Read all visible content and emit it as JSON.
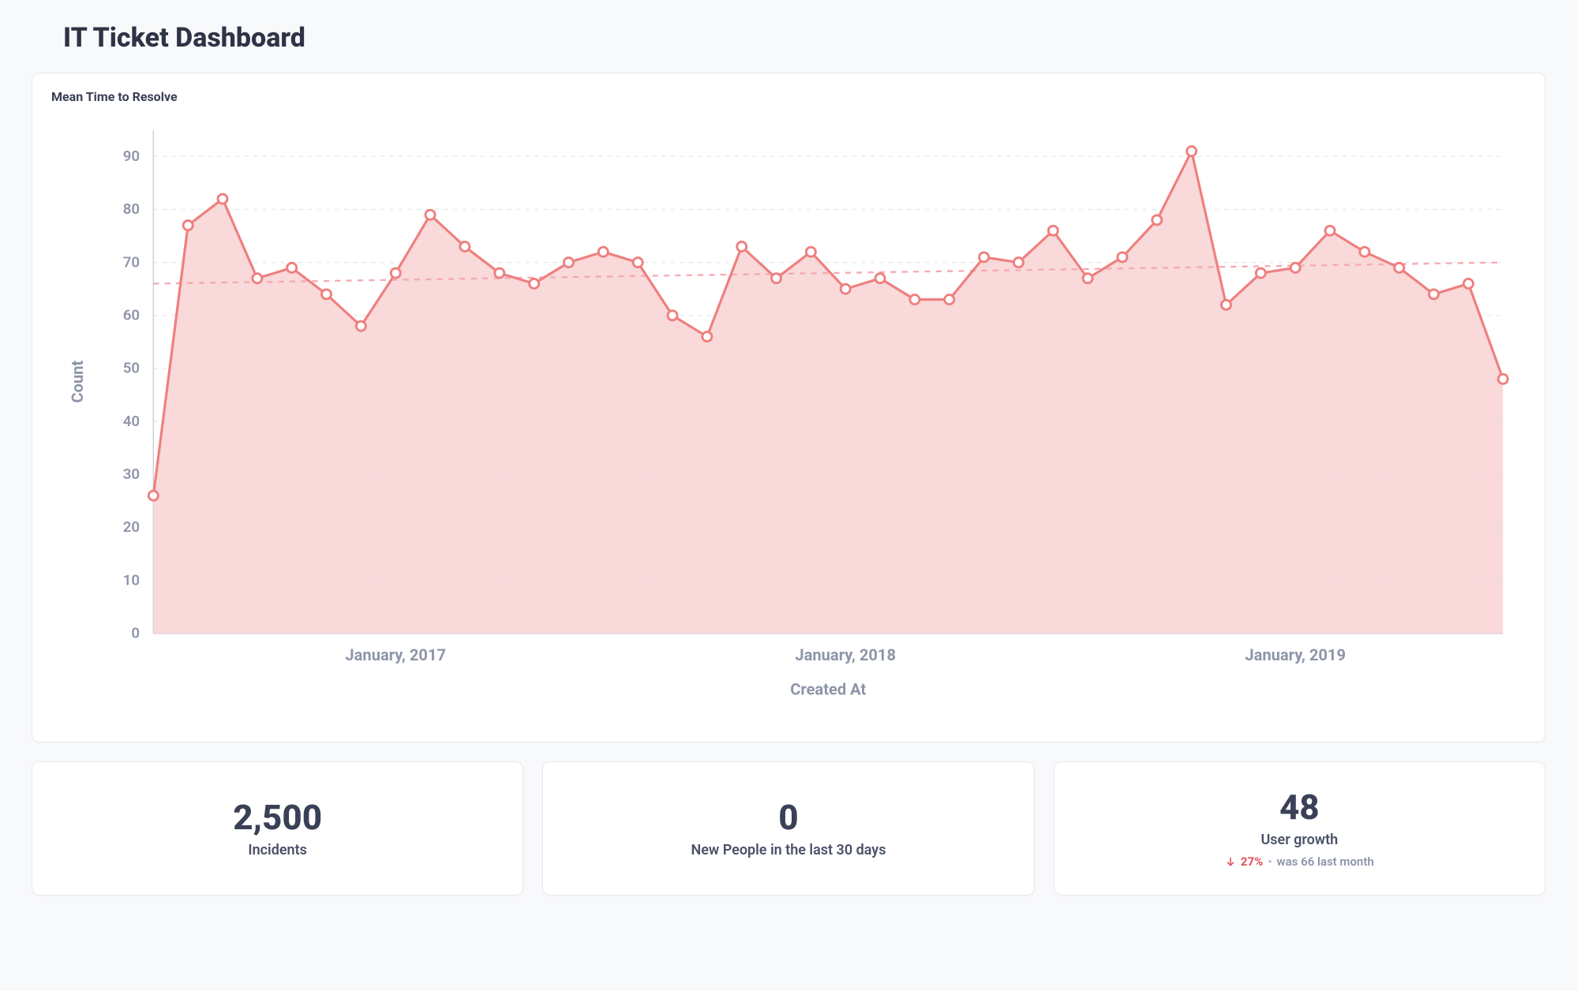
{
  "page_title": "IT Ticket Dashboard",
  "chart": {
    "title": "Mean Time to Resolve",
    "xlabel": "Created At",
    "ylabel": "Count"
  },
  "chart_data": {
    "type": "area",
    "ylabel": "Count",
    "xlabel": "Created At",
    "title": "Mean Time to Resolve",
    "ylim": [
      0,
      95
    ],
    "y_ticks": [
      0,
      10,
      20,
      30,
      40,
      50,
      60,
      70,
      80,
      90
    ],
    "x_tick_labels": [
      "January, 2017",
      "January, 2018",
      "January, 2019"
    ],
    "x_tick_positions": [
      7,
      20,
      33
    ],
    "series": [
      {
        "name": "Mean Time to Resolve",
        "values": [
          26,
          77,
          82,
          67,
          69,
          64,
          58,
          68,
          79,
          73,
          68,
          66,
          70,
          72,
          70,
          60,
          56,
          73,
          67,
          72,
          65,
          67,
          63,
          63,
          71,
          70,
          76,
          67,
          71,
          78,
          91,
          62,
          68,
          69,
          76,
          72,
          69,
          64,
          66,
          48
        ]
      }
    ],
    "goal": {
      "start_value": 66,
      "end_value": 70
    }
  },
  "stats": {
    "incidents": {
      "value": "2,500",
      "label": "Incidents"
    },
    "new_people": {
      "value": "0",
      "label": "New People in the last 30 days"
    },
    "user_growth": {
      "value": "48",
      "label": "User growth",
      "change_pct": "27%",
      "was_text": "was 66 last month",
      "direction": "down"
    }
  }
}
